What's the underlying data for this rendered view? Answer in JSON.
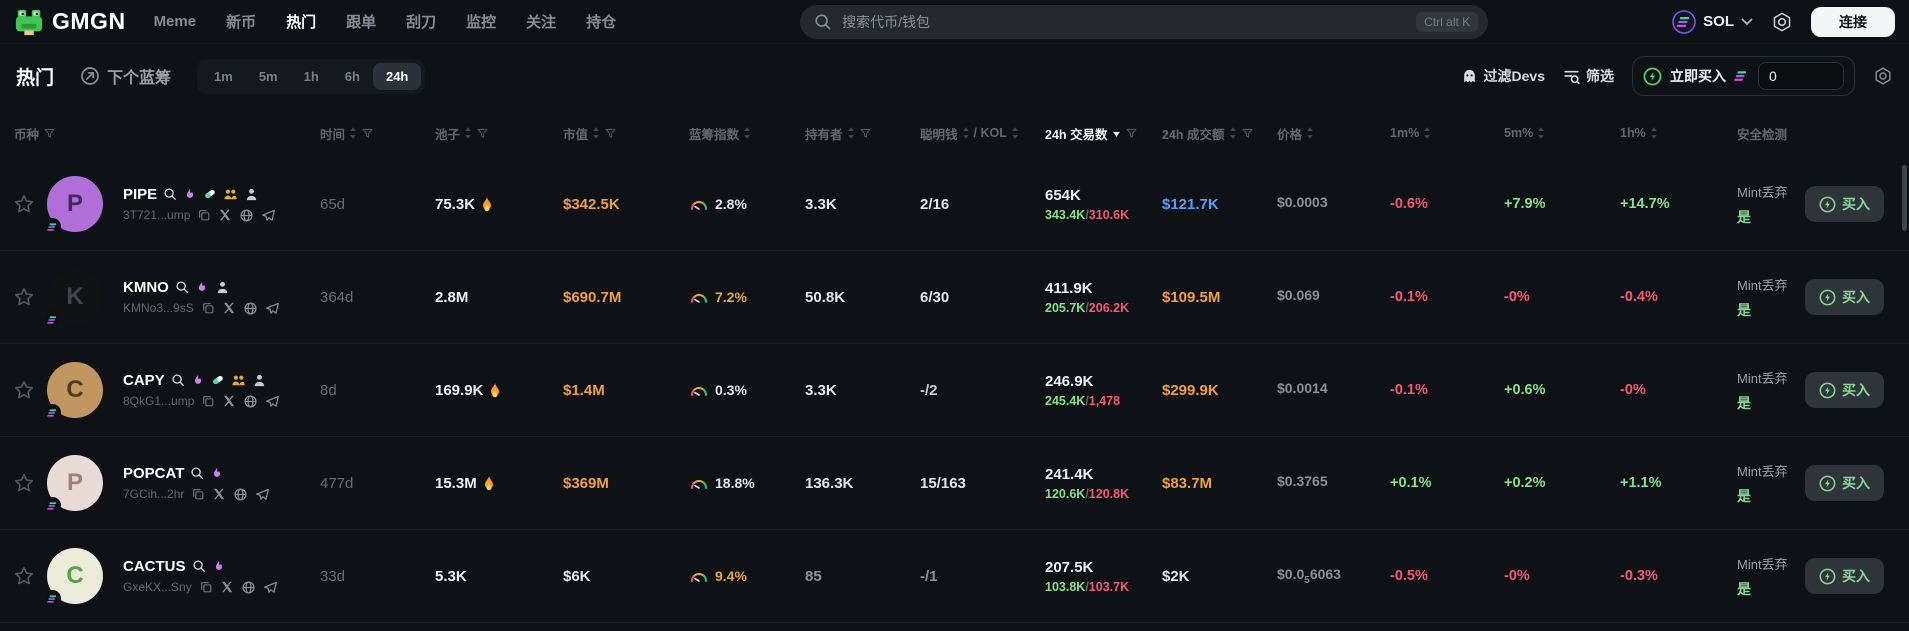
{
  "topbar": {
    "logo": "GMGN",
    "nav": [
      {
        "label": "Meme",
        "active": false
      },
      {
        "label": "新币",
        "active": false
      },
      {
        "label": "热门",
        "active": true
      },
      {
        "label": "跟单",
        "active": false
      },
      {
        "label": "刮刀",
        "active": false
      },
      {
        "label": "监控",
        "active": false
      },
      {
        "label": "关注",
        "active": false
      },
      {
        "label": "持仓",
        "active": false
      }
    ],
    "search_placeholder": "搜索代币/钱包",
    "search_shortcut": "Ctrl alt K",
    "chain": "SOL",
    "connect_label": "连接"
  },
  "subbar": {
    "title": "热门",
    "next_bluechip": "下个蓝筹",
    "timeframes": [
      {
        "label": "1m",
        "active": false
      },
      {
        "label": "5m",
        "active": false
      },
      {
        "label": "1h",
        "active": false
      },
      {
        "label": "6h",
        "active": false
      },
      {
        "label": "24h",
        "active": true
      }
    ],
    "filter_devs": "过滤Devs",
    "filter": "筛选",
    "buy_now": "立即买入",
    "buy_amount": "0"
  },
  "table": {
    "headers": {
      "coin": "币种",
      "age": "时间",
      "pool": "池子",
      "mcap": "市值",
      "bluechip": "蓝筹指数",
      "holders": "持有者",
      "smart": "聪明钱",
      "kol": "/ KOL",
      "txs": "24h 交易数",
      "volume": "24h 成交额",
      "price": "价格",
      "m1": "1m%",
      "m5": "5m%",
      "h1": "1h%",
      "security": "安全检测"
    },
    "security_label": "Mint丢弃",
    "buy_label": "买入",
    "colors": {
      "green": "#86e28b",
      "red": "#f25c72",
      "orange": "#f0a13d",
      "blue": "#5ba0f5",
      "yellow": "#e5aa3c"
    }
  },
  "rows": [
    {
      "name": "PIPE",
      "address": "3T721...ump",
      "age": "65d",
      "pool": "75.3K",
      "pool_fire": true,
      "mcap": "$342.5K",
      "mcap_color": "#f0a13d",
      "bluechip": "2.8%",
      "bluechip_color": "#e3e5e8",
      "holders": "3.3K",
      "holders_color": "#e3e5e8",
      "smart": "2/16",
      "smart_color": "#e3e5e8",
      "txs": "654K",
      "buys": "343.4K",
      "sells": "310.6K",
      "vol": "$121.7K",
      "vol_color": "#5ba0f5",
      "price": "$0.0003",
      "price_sub": "",
      "price_rest": "",
      "m1": "-0.6%",
      "m1_color": "#f25c72",
      "m5": "+7.9%",
      "m5_color": "#86e28b",
      "h1": "+14.7%",
      "h1_color": "#86e28b",
      "security": "是",
      "avatar": {
        "letter": "P",
        "bg": "#b06fd8",
        "fg": "#472561"
      },
      "icons": {
        "search": true,
        "flame": true,
        "pill": true,
        "users": true,
        "dev": true
      }
    },
    {
      "name": "KMNO",
      "address": "KMNo3...9sS",
      "age": "364d",
      "pool": "2.8M",
      "pool_fire": false,
      "mcap": "$690.7M",
      "mcap_color": "#f0a13d",
      "bluechip": "7.2%",
      "bluechip_color": "#e5aa3c",
      "holders": "50.8K",
      "holders_color": "#e3e5e8",
      "smart": "6/30",
      "smart_color": "#e3e5e8",
      "txs": "411.9K",
      "buys": "205.7K",
      "sells": "206.2K",
      "vol": "$109.5M",
      "vol_color": "#f0a13d",
      "price": "$0.069",
      "price_sub": "",
      "price_rest": "",
      "m1": "-0.1%",
      "m1_color": "#f25c72",
      "m5": "-0%",
      "m5_color": "#f25c72",
      "h1": "-0.4%",
      "h1_color": "#f25c72",
      "security": "是",
      "avatar": {
        "letter": "K",
        "bg": "#101214",
        "fg": "#40454c"
      },
      "icons": {
        "search": true,
        "flame": true,
        "pill": false,
        "users": false,
        "dev": true
      }
    },
    {
      "name": "CAPY",
      "address": "8QkG1...ump",
      "age": "8d",
      "pool": "169.9K",
      "pool_fire": true,
      "mcap": "$1.4M",
      "mcap_color": "#f0a13d",
      "bluechip": "0.3%",
      "bluechip_color": "#e3e5e8",
      "holders": "3.3K",
      "holders_color": "#e3e5e8",
      "smart": "-/2",
      "smart_color": "#c8ccd2",
      "txs": "246.9K",
      "buys": "245.4K",
      "sells": "1,478",
      "vol": "$299.9K",
      "vol_color": "#f0a13d",
      "price": "$0.0014",
      "price_sub": "",
      "price_rest": "",
      "m1": "-0.1%",
      "m1_color": "#f25c72",
      "m5": "+0.6%",
      "m5_color": "#86e28b",
      "h1": "-0%",
      "h1_color": "#f25c72",
      "security": "是",
      "avatar": {
        "letter": "C",
        "bg": "#c29660",
        "fg": "#4f3a1e"
      },
      "icons": {
        "search": true,
        "flame": true,
        "pill": true,
        "users": true,
        "dev": true
      }
    },
    {
      "name": "POPCAT",
      "address": "7GCih...2hr",
      "age": "477d",
      "pool": "15.3M",
      "pool_fire": true,
      "mcap": "$369M",
      "mcap_color": "#f0a13d",
      "bluechip": "18.8%",
      "bluechip_color": "#e3e5e8",
      "holders": "136.3K",
      "holders_color": "#e3e5e8",
      "smart": "15/163",
      "smart_color": "#e3e5e8",
      "txs": "241.4K",
      "buys": "120.6K",
      "sells": "120.8K",
      "vol": "$83.7M",
      "vol_color": "#f0a13d",
      "price": "$0.3765",
      "price_sub": "",
      "price_rest": "",
      "m1": "+0.1%",
      "m1_color": "#86e28b",
      "m5": "+0.2%",
      "m5_color": "#86e28b",
      "h1": "+1.1%",
      "h1_color": "#86e28b",
      "security": "是",
      "avatar": {
        "letter": "P",
        "bg": "#e9dad3",
        "fg": "#9c8276"
      },
      "icons": {
        "search": true,
        "flame": true,
        "pill": false,
        "users": false,
        "dev": false
      }
    },
    {
      "name": "CACTUS",
      "address": "GxeKX...Sny",
      "age": "33d",
      "pool": "5.3K",
      "pool_fire": false,
      "mcap": "$6K",
      "mcap_color": "#e3e5e8",
      "bluechip": "9.4%",
      "bluechip_color": "#e5aa3c",
      "holders": "85",
      "holders_color": "#8d939b",
      "smart": "-/1",
      "smart_color": "#8d939b",
      "txs": "207.5K",
      "buys": "103.8K",
      "sells": "103.7K",
      "vol": "$2K",
      "vol_color": "#e3e5e8",
      "price": "$0.0",
      "price_sub": "5",
      "price_rest": "6063",
      "m1": "-0.5%",
      "m1_color": "#f25c72",
      "m5": "-0%",
      "m5_color": "#f25c72",
      "h1": "-0.3%",
      "h1_color": "#f25c72",
      "security": "是",
      "avatar": {
        "letter": "C",
        "bg": "#ecead9",
        "fg": "#55a23c"
      },
      "icons": {
        "search": true,
        "flame": true,
        "pill": false,
        "users": false,
        "dev": false
      }
    }
  ]
}
